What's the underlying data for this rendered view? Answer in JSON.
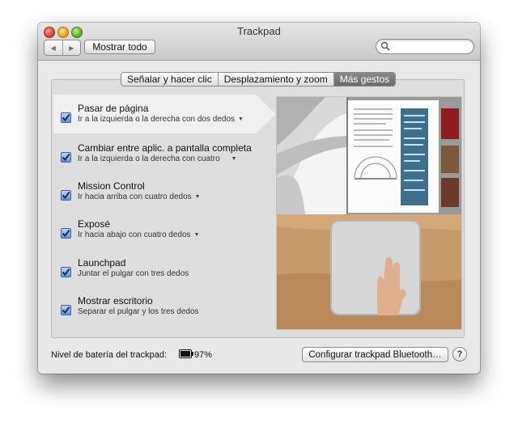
{
  "window": {
    "title": "Trackpad",
    "show_all_label": "Mostrar todo",
    "search_placeholder": ""
  },
  "tabs": [
    {
      "label": "Señalar y hacer clic",
      "active": false
    },
    {
      "label": "Desplazamiento y zoom",
      "active": false
    },
    {
      "label": "Más gestos",
      "active": true
    }
  ],
  "gestures": [
    {
      "title": "Pasar de página",
      "subtitle": "Ir a la izquierda  o la derecha con dos dedos",
      "has_menu": true,
      "checked": true
    },
    {
      "title": "Cambiar entre aplic. a pantalla completa",
      "subtitle": "Ir a la izquierda o la derecha con cuatro",
      "has_menu": true,
      "checked": true
    },
    {
      "title": "Mission Control",
      "subtitle": "Ir hacia arriba con cuatro dedos",
      "has_menu": true,
      "checked": true
    },
    {
      "title": "Exposé",
      "subtitle": "Ir hacia abajo con cuatro dedos",
      "has_menu": true,
      "checked": true
    },
    {
      "title": "Launchpad",
      "subtitle": "Juntar el pulgar con tres dedos",
      "has_menu": false,
      "checked": true
    },
    {
      "title": "Mostrar escritorio",
      "subtitle": "Separar el pulgar y los tres dedos",
      "has_menu": false,
      "checked": true
    }
  ],
  "footer": {
    "battery_label": "Nivel de batería del trackpad:",
    "battery_value": "97%",
    "bluetooth_button": "Configurar trackpad Bluetooth…",
    "help_label": "?"
  },
  "colors": {
    "accent": "#4a7fd6",
    "active_tab": "#7a7a7a"
  }
}
